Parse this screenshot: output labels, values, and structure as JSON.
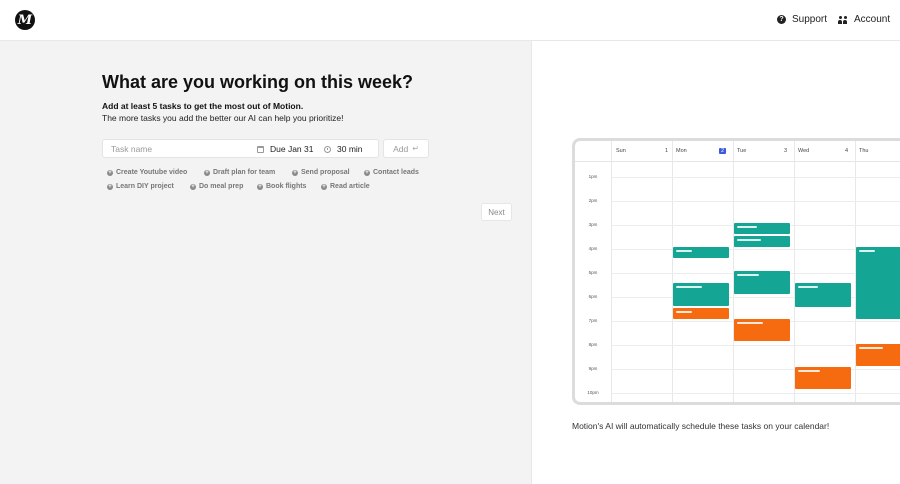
{
  "header": {
    "logo_letter": "M",
    "support_label": "Support",
    "account_label": "Account",
    "icons": [
      "help-icon",
      "people-icon"
    ]
  },
  "onboarding": {
    "title": "What are you working on this week?",
    "subtitle_bold": "Add at least 5 tasks to get the most out of Motion.",
    "subtitle": "The more tasks you add the better our AI can help you prioritize!",
    "task_placeholder": "Task name",
    "due_label": "Due Jan 31",
    "duration_label": "30 min",
    "add_label": "Add",
    "add_icon": "↵",
    "next_label": "Next",
    "suggestions": [
      "Create Youtube video",
      "Draft plan for team",
      "Send proposal",
      "Contact leads",
      "Learn DIY project",
      "Do meal prep",
      "Book flights",
      "Read article"
    ]
  },
  "calendar": {
    "days": [
      {
        "name": "Sun",
        "num": "1"
      },
      {
        "name": "Mon",
        "num": "2"
      },
      {
        "name": "Tue",
        "num": "3"
      },
      {
        "name": "Wed",
        "num": "4"
      },
      {
        "name": "Thu",
        "num": ""
      }
    ],
    "today_index": 1,
    "hours": [
      "1pm",
      "2pm",
      "3pm",
      "4pm",
      "5pm",
      "6pm",
      "7pm",
      "8pm",
      "9pm",
      "10pm"
    ],
    "colors": {
      "teal": "#14a594",
      "orange": "#f76b10"
    },
    "caption": "Motion's AI will automatically schedule these tasks on your calendar!"
  }
}
